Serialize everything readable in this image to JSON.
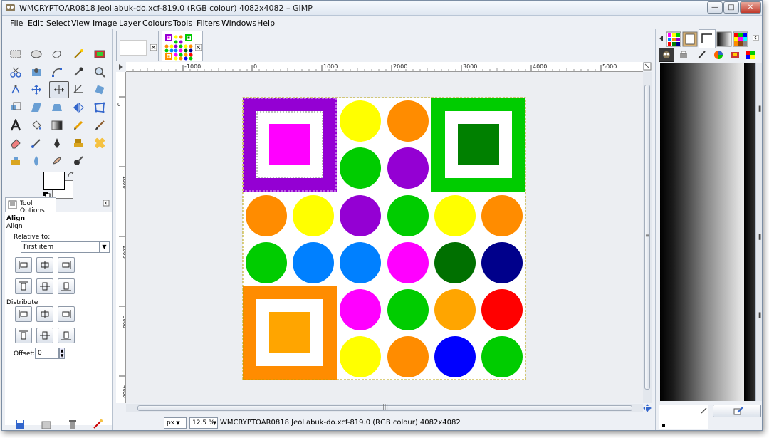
{
  "window": {
    "title": "WMCRYPTOAR0818 Jeollabuk-do.xcf-819.0 (RGB colour) 4082x4082 – GIMP",
    "minimize": "—",
    "maximize": "□",
    "close": "✕"
  },
  "menu": [
    "File",
    "Edit",
    "Select",
    "View",
    "Image",
    "Layer",
    "Colours",
    "Tools",
    "Filters",
    "Windows",
    "Help"
  ],
  "tool_options": {
    "tab_label": "Tool Options",
    "tool_name": "Align",
    "tool_name_sub": "Align",
    "relative_to_label": "Relative to:",
    "relative_to_value": "First item",
    "distribute_label": "Distribute",
    "offset_label": "Offset:",
    "offset_value": "0"
  },
  "ruler": {
    "h_labels": [
      "-1000",
      "0",
      "1000",
      "2000",
      "3000",
      "4000",
      "5000"
    ],
    "v_labels": [
      "0",
      "1000",
      "2000",
      "3000",
      "4000"
    ]
  },
  "status": {
    "unit": "px",
    "zoom": "12.5 %",
    "text": "WMCRYPTOAR0818 Jeollabuk-do.xcf-819.0 (RGB colour) 4082x4082"
  },
  "icons": {
    "tab_close": "close-icon",
    "tool_options_tab": "tool-options-icon"
  },
  "colors": {
    "purple": "#9400d3",
    "magenta": "#ff00ff",
    "green": "#00cc00",
    "dark_green": "#008000",
    "orange": "#ff8c00",
    "light_orange": "#ffa500",
    "yellow": "#ffff00",
    "blue": "#0080ff",
    "navy": "#00008b",
    "red": "#ff0000",
    "pure_blue": "#0000ff",
    "forest": "#007000"
  },
  "grid": {
    "circles": [
      [
        "",
        "",
        "yellow",
        "orange",
        "",
        ""
      ],
      [
        "",
        "",
        "green",
        "purple",
        "",
        ""
      ],
      [
        "orange",
        "yellow",
        "purple",
        "green",
        "yellow",
        "orange"
      ],
      [
        "green",
        "blue",
        "blue",
        "magenta",
        "forest",
        "navy"
      ],
      [
        "",
        "",
        "magenta",
        "green",
        "light_orange",
        "red"
      ],
      [
        "",
        "",
        "yellow",
        "orange",
        "pure_blue",
        "green"
      ]
    ]
  }
}
